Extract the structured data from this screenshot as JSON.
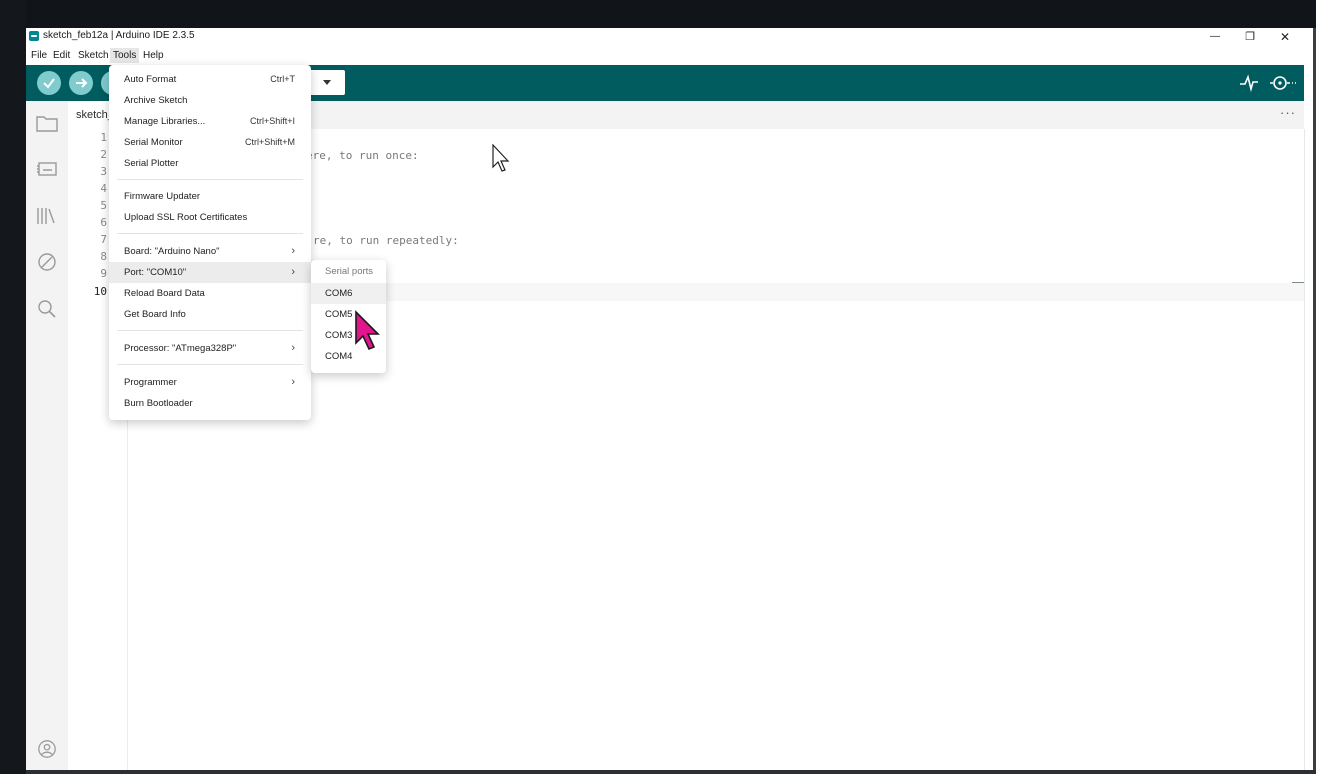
{
  "window": {
    "title": "sketch_feb12a | Arduino IDE 2.3.5",
    "minimize": "—",
    "maximize": "❐",
    "close": "✕"
  },
  "menubar": {
    "items": [
      "File",
      "Edit",
      "Sketch",
      "Tools",
      "Help"
    ],
    "active": "Tools"
  },
  "toolbar": {
    "verify_icon": "check-icon",
    "upload_icon": "arrow-right-icon",
    "serial_plotter_icon": "plotter-icon",
    "serial_monitor_icon": "monitor-icon"
  },
  "tab": {
    "label": "sketch_feb12a.ino",
    "more": "···"
  },
  "editor": {
    "line_numbers": [
      "1",
      "2",
      "3",
      "4",
      "5",
      "6",
      "7",
      "8",
      "9",
      "10"
    ],
    "current_line": "10",
    "visible_code": {
      "line2": "ere, to run once:",
      "line7": "re, to run repeatedly:"
    }
  },
  "tools_menu": {
    "items": [
      {
        "label": "Auto Format",
        "shortcut": "Ctrl+T"
      },
      {
        "label": "Archive Sketch",
        "shortcut": ""
      },
      {
        "label": "Manage Libraries...",
        "shortcut": "Ctrl+Shift+I"
      },
      {
        "label": "Serial Monitor",
        "shortcut": "Ctrl+Shift+M"
      },
      {
        "label": "Serial Plotter",
        "shortcut": ""
      },
      {
        "label": "Firmware Updater",
        "shortcut": ""
      },
      {
        "label": "Upload SSL Root Certificates",
        "shortcut": ""
      },
      {
        "label": "Board: \"Arduino Nano\"",
        "submenu": true
      },
      {
        "label": "Port: \"COM10\"",
        "submenu": true
      },
      {
        "label": "Reload Board Data",
        "shortcut": ""
      },
      {
        "label": "Get Board Info",
        "shortcut": ""
      },
      {
        "label": "Processor: \"ATmega328P\"",
        "submenu": true
      },
      {
        "label": "Programmer",
        "submenu": true
      },
      {
        "label": "Burn Bootloader",
        "shortcut": ""
      }
    ],
    "submenu_arrow": "›"
  },
  "port_submenu": {
    "header": "Serial ports",
    "items": [
      "COM6",
      "COM5",
      "COM3",
      "COM4"
    ]
  },
  "colors": {
    "toolbar": "#005c5f",
    "toolbar_button": "#7fcbcd",
    "cursor_highlight": "#e0168c"
  }
}
